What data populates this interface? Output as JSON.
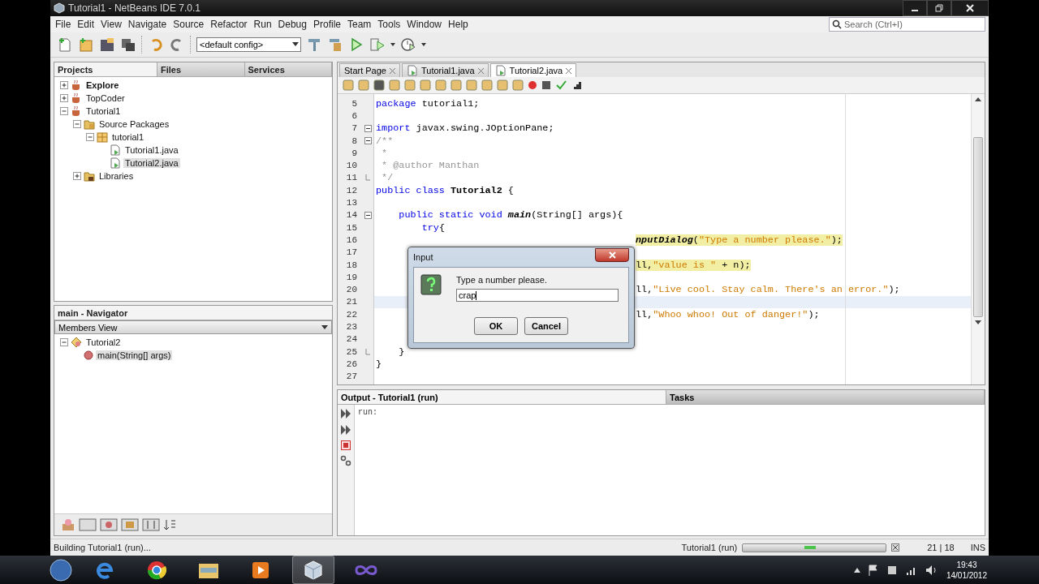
{
  "window": {
    "title": "Tutorial1 - NetBeans IDE 7.0.1"
  },
  "menu": [
    "File",
    "Edit",
    "View",
    "Navigate",
    "Source",
    "Refactor",
    "Run",
    "Debug",
    "Profile",
    "Team",
    "Tools",
    "Window",
    "Help"
  ],
  "config": {
    "value": "<default config>"
  },
  "search": {
    "placeholder": "Search (Ctrl+I)"
  },
  "projects_panel": {
    "tabs": [
      {
        "label": "Projects",
        "selected": true
      },
      {
        "label": "Files",
        "selected": false
      },
      {
        "label": "Services",
        "selected": false
      }
    ],
    "tree": [
      {
        "label": "Explore",
        "kind": "project",
        "main": true,
        "expanded": false,
        "selected": false
      },
      {
        "label": "TopCoder",
        "kind": "project",
        "main": false,
        "expanded": false,
        "selected": false
      },
      {
        "label": "Tutorial1",
        "kind": "project",
        "main": false,
        "expanded": true,
        "selected": false,
        "children": [
          {
            "label": "Source Packages",
            "kind": "source-folder",
            "expanded": true,
            "selected": false,
            "children": [
              {
                "label": "tutorial1",
                "kind": "package",
                "expanded": true,
                "selected": false,
                "children": [
                  {
                    "label": "Tutorial1.java",
                    "kind": "java-file",
                    "selected": false
                  },
                  {
                    "label": "Tutorial2.java",
                    "kind": "java-file",
                    "selected": true
                  }
                ]
              }
            ]
          },
          {
            "label": "Libraries",
            "kind": "libraries",
            "expanded": false,
            "selected": false
          }
        ]
      }
    ]
  },
  "navigator": {
    "title": "main - Navigator",
    "view": "Members View",
    "tree": [
      {
        "label": "Tutorial2",
        "kind": "class",
        "expanded": true,
        "selected": false,
        "children": [
          {
            "label": "main(String[] args)",
            "kind": "method",
            "selected": true
          }
        ]
      }
    ]
  },
  "editor": {
    "tabs": [
      {
        "label": "Start Page",
        "selected": false
      },
      {
        "label": "Tutorial1.java",
        "selected": false
      },
      {
        "label": "Tutorial2.java",
        "selected": true
      }
    ],
    "lines": [
      {
        "number": "5",
        "kind": "code",
        "segments": [
          {
            "text": "package",
            "kind": "keyword"
          },
          {
            "text": " tutorial1;",
            "kind": "plain"
          }
        ]
      },
      {
        "number": "6",
        "kind": "code"
      },
      {
        "number": "7",
        "kind": "code",
        "fold": true,
        "segments": [
          {
            "text": "import",
            "kind": "keyword"
          },
          {
            "text": " javax.swing.JOptionPane;",
            "kind": "plain"
          }
        ]
      },
      {
        "number": "8",
        "kind": "code",
        "fold": true,
        "segments": [
          {
            "text": "/**",
            "kind": "comment"
          }
        ]
      },
      {
        "number": "9",
        "kind": "code",
        "segments": [
          {
            "text": " *",
            "kind": "comment"
          }
        ]
      },
      {
        "number": "10",
        "kind": "code",
        "segments": [
          {
            "text": " * @author Manthan",
            "kind": "comment"
          }
        ]
      },
      {
        "number": "11",
        "kind": "code",
        "fold_end": true,
        "segments": [
          {
            "text": " */",
            "kind": "comment"
          }
        ]
      },
      {
        "number": "12",
        "kind": "code",
        "segments": [
          {
            "text": "public class",
            "kind": "keyword"
          },
          {
            "text": " Tutorial2",
            "kind": "bold"
          },
          {
            "text": " {",
            "kind": "plain"
          }
        ]
      },
      {
        "number": "13",
        "kind": "code"
      },
      {
        "number": "14",
        "kind": "code",
        "fold": true,
        "segments": [
          {
            "text": "    public static void",
            "kind": "keyword"
          },
          {
            "text": " main",
            "kind": "method"
          },
          {
            "text": "(String[] args){",
            "kind": "plain"
          }
        ]
      },
      {
        "number": "15",
        "kind": "code",
        "segments": [
          {
            "text": "        try",
            "kind": "keyword"
          },
          {
            "text": "{",
            "kind": "plain"
          }
        ]
      },
      {
        "number": "16",
        "kind": "tail",
        "highlight": true,
        "segments": [
          {
            "text": "nputDialog",
            "kind": "method"
          },
          {
            "text": "(",
            "kind": "plain"
          },
          {
            "text": "\"Type a number please.\"",
            "kind": "string"
          },
          {
            "text": ");",
            "kind": "plain"
          }
        ]
      },
      {
        "number": "17",
        "kind": "code"
      },
      {
        "number": "18",
        "kind": "tail",
        "highlight": true,
        "segments": [
          {
            "text": "ll,",
            "kind": "plain"
          },
          {
            "text": "\"value is \"",
            "kind": "string"
          },
          {
            "text": " + n);",
            "kind": "plain"
          }
        ]
      },
      {
        "number": "19",
        "kind": "code"
      },
      {
        "number": "20",
        "kind": "tail",
        "segments": [
          {
            "text": "ll,",
            "kind": "plain"
          },
          {
            "text": "\"Live cool. Stay calm. There's an error.\"",
            "kind": "string"
          },
          {
            "text": ");",
            "kind": "plain"
          }
        ]
      },
      {
        "number": "21",
        "kind": "code",
        "current": true
      },
      {
        "number": "22",
        "kind": "tail",
        "segments": [
          {
            "text": "ll,",
            "kind": "plain"
          },
          {
            "text": "\"Whoo whoo! Out of danger!\"",
            "kind": "string"
          },
          {
            "text": ");",
            "kind": "plain"
          }
        ]
      },
      {
        "number": "23",
        "kind": "code"
      },
      {
        "number": "24",
        "kind": "code"
      },
      {
        "number": "25",
        "kind": "code",
        "fold_end": true,
        "segments": [
          {
            "text": "    }",
            "kind": "plain"
          }
        ]
      },
      {
        "number": "26",
        "kind": "code",
        "segments": [
          {
            "text": "}",
            "kind": "plain"
          }
        ]
      },
      {
        "number": "27",
        "kind": "code"
      }
    ]
  },
  "dialog": {
    "title": "Input",
    "message": "Type a number please.",
    "value": "crap",
    "buttons": [
      "OK",
      "Cancel"
    ]
  },
  "output": {
    "tabs": [
      {
        "label": "Output - Tutorial1 (run)",
        "selected": true
      },
      {
        "label": "Tasks",
        "selected": false
      }
    ],
    "text": "run:"
  },
  "status_bar": {
    "message": "Building Tutorial1 (run)...",
    "task": "Tutorial1 (run)",
    "progress": {
      "level": 0.47
    },
    "position": "21 | 18",
    "mode": "INS"
  },
  "taskbar": {
    "time": "19:43",
    "date": "14/01/2012"
  }
}
